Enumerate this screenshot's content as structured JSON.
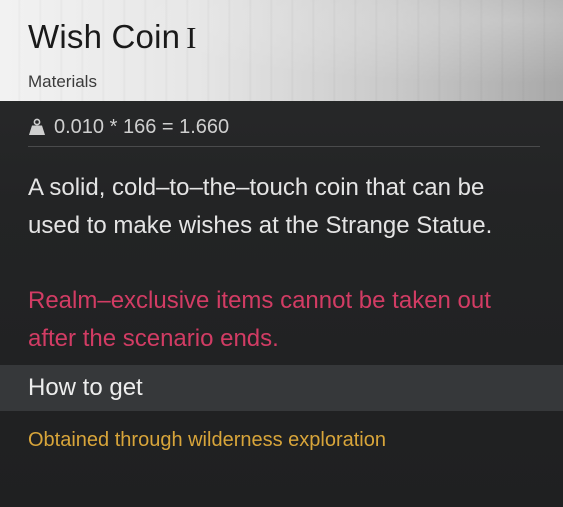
{
  "item": {
    "name": "Wish Coin",
    "rank": "I",
    "category": "Materials"
  },
  "weight": {
    "icon": "weight-icon",
    "formula": "0.010 * 166 = 1.660"
  },
  "description": "A solid, cold–to–the–touch coin that can be used to make wishes at the Strange Statue.",
  "warning": "Realm–exclusive items cannot be taken out after the scenario ends.",
  "how_to_get": {
    "title": "How to get",
    "source": "Obtained through wilderness exploration"
  },
  "colors": {
    "warning": "#d23c64",
    "source": "#d8a53a",
    "text": "#e4e4e4",
    "background": "#232425"
  }
}
